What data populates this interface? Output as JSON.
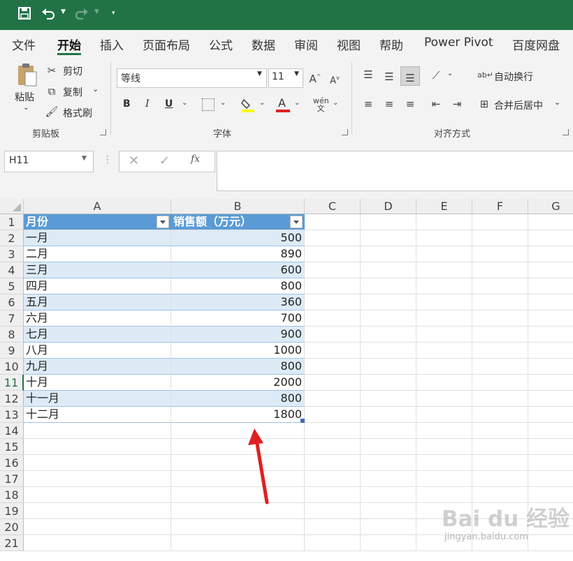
{
  "quick_access": {
    "save_icon": "save-icon",
    "undo_icon": "undo-icon",
    "redo_icon": "redo-icon",
    "customize_icon": "customize-icon"
  },
  "tabs": [
    "文件",
    "开始",
    "插入",
    "页面布局",
    "公式",
    "数据",
    "审阅",
    "视图",
    "帮助",
    "Power Pivot",
    "百度网盘"
  ],
  "active_tab": "开始",
  "ribbon": {
    "clipboard": {
      "paste": "粘贴",
      "cut": "剪切",
      "copy": "复制",
      "format_painter": "格式刷",
      "group_label": "剪贴板"
    },
    "font": {
      "font_name": "等线",
      "font_size": "11",
      "bold": "B",
      "italic": "I",
      "underline": "U",
      "group_label": "字体"
    },
    "alignment": {
      "wrap_text": "自动换行",
      "merge_center": "合并后居中",
      "group_label": "对齐方式"
    }
  },
  "formula_bar": {
    "name_box": "H11",
    "fx": "fx",
    "formula": ""
  },
  "grid": {
    "columns": [
      "A",
      "B",
      "C",
      "D",
      "E",
      "F",
      "G"
    ],
    "rows": [
      "1",
      "2",
      "3",
      "4",
      "5",
      "6",
      "7",
      "8",
      "9",
      "10",
      "11",
      "12",
      "13",
      "14",
      "15",
      "16",
      "17",
      "18",
      "19",
      "20",
      "21"
    ],
    "table_headers": [
      "月份",
      "销售额（万元）"
    ],
    "table_rows": [
      [
        "一月",
        "500"
      ],
      [
        "二月",
        "890"
      ],
      [
        "三月",
        "600"
      ],
      [
        "四月",
        "800"
      ],
      [
        "五月",
        "360"
      ],
      [
        "六月",
        "700"
      ],
      [
        "七月",
        "900"
      ],
      [
        "八月",
        "1000"
      ],
      [
        "九月",
        "800"
      ],
      [
        "十月",
        "2000"
      ],
      [
        "十一月",
        "800"
      ],
      [
        "十二月",
        "1800"
      ]
    ]
  },
  "watermark": {
    "brand": "Bai du 经验",
    "url": "jingyan.baidu.com"
  },
  "colors": {
    "accent": "#217346",
    "table_header": "#5b9bd5",
    "band": "#ddebf7",
    "arrow": "#e02020"
  }
}
